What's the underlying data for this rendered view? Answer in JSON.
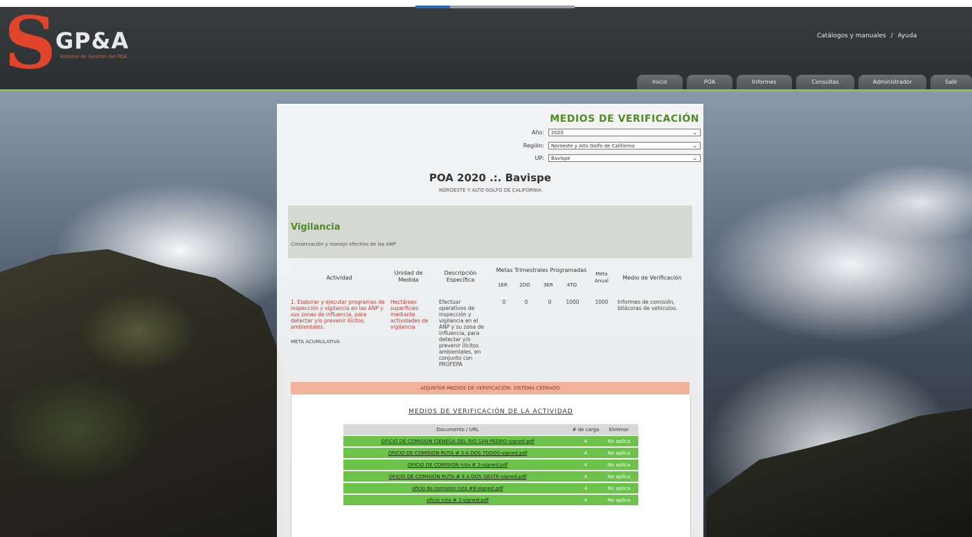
{
  "header": {
    "logo_letter": "S",
    "logo_text": "GP&A",
    "logo_sub": "Sistema de Gestion del POA",
    "top_links": [
      "Catálogos y manuales",
      "Ayuda"
    ]
  },
  "nav": [
    "Inicio",
    "POA",
    "Informes",
    "Consultas",
    "Administrador",
    "Salir"
  ],
  "filters": {
    "title": "MEDIOS DE VERIFICACIÓN",
    "anio_label": "Año:",
    "anio_value": "2020",
    "region_label": "Región:",
    "region_value": "Noroeste y Alto Golfo de California",
    "up_label": "UP:",
    "up_value": "Bavispe"
  },
  "poa": {
    "title": "POA 2020 .:. Bavispe",
    "subtitle": "NOROESTE Y ALTO GOLFO DE CALIFORNIA"
  },
  "section": {
    "title": "Vigilancia",
    "description": "Conservación y manejo efectivo de las ANP"
  },
  "table": {
    "headers": {
      "actividad": "Actividad",
      "unidad": "Unidad de Medida",
      "descripcion": "Descripción Específica",
      "metas": "Metas Trimestrales Programadas",
      "q1": "1ER",
      "q2": "2DO",
      "q3": "3ER",
      "q4": "4TO",
      "meta_anual": "Meta Anual",
      "medio": "Medio de Verificación"
    },
    "row": {
      "actividad": "1. Elaborar y ejecutar programas de inspección y vigilancia en las ANP y sus zonas de influencia, para detectar y/o prevenir ilícitos ambientales.",
      "meta_tag": "META ACUMULATIVA",
      "unidad": "Hectáreas superficies mediante actividades de vigilancia",
      "descripcion": "Efectuar operativos de inspección y vigilancia en el ANP y su zona de influencia, para detectar y/o prevenir ilícitos ambientales, en conjunto con PROFEPA",
      "q1": "0",
      "q2": "0",
      "q3": "0",
      "q4": "1000",
      "meta_anual": "1000",
      "medio": "Informes de comisión, bitácoras de vehículos."
    }
  },
  "alert": "ADJUNTAR MEDIOS DE VERIFICACIÓN: SISTEMA CERRADO",
  "docs": {
    "title": "MEDIOS DE VERIFICACIÓN DE LA ACTIVIDAD",
    "col_doc": "Documento / URL",
    "col_carga": "# de carga",
    "col_elim": "Eliminar",
    "rows": [
      {
        "name": "OFICIO DE COMISION CIENEGA DEL RIO SAN PEDRO-signed.pdf",
        "carga": "4",
        "elim": "No aplica"
      },
      {
        "name": "OFICIO DE COMISION RUTA # 3 A DOS TODOS-signed.pdf",
        "carga": "4",
        "elim": "No aplica"
      },
      {
        "name": "OFICIO DE COMISION ruta # 3-signed.pdf",
        "carga": "4",
        "elim": "No aplica"
      },
      {
        "name": "OFICIO DE COMISION RUTA # 4 A DOS OESTE-signed.pdf",
        "carga": "4",
        "elim": "No aplica"
      },
      {
        "name": "oficio de comision ruta #8-signed.pdf",
        "carga": "4",
        "elim": "No aplica"
      },
      {
        "name": "oficio ruta # 1-signed.pdf",
        "carga": "4",
        "elim": "No aplica"
      }
    ]
  }
}
